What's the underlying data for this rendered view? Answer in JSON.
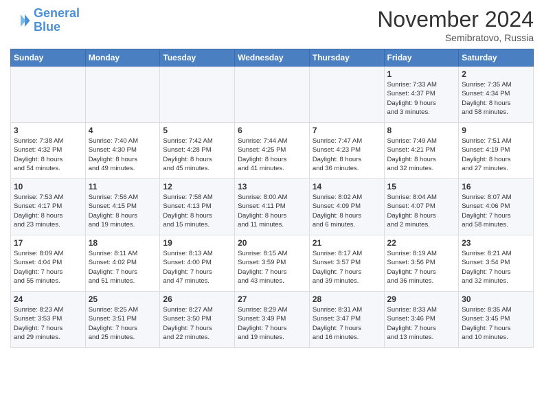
{
  "header": {
    "logo_line1": "General",
    "logo_line2": "Blue",
    "month": "November 2024",
    "location": "Semibratovo, Russia"
  },
  "weekdays": [
    "Sunday",
    "Monday",
    "Tuesday",
    "Wednesday",
    "Thursday",
    "Friday",
    "Saturday"
  ],
  "weeks": [
    [
      {
        "day": "",
        "info": ""
      },
      {
        "day": "",
        "info": ""
      },
      {
        "day": "",
        "info": ""
      },
      {
        "day": "",
        "info": ""
      },
      {
        "day": "",
        "info": ""
      },
      {
        "day": "1",
        "info": "Sunrise: 7:33 AM\nSunset: 4:37 PM\nDaylight: 9 hours\nand 3 minutes."
      },
      {
        "day": "2",
        "info": "Sunrise: 7:35 AM\nSunset: 4:34 PM\nDaylight: 8 hours\nand 58 minutes."
      }
    ],
    [
      {
        "day": "3",
        "info": "Sunrise: 7:38 AM\nSunset: 4:32 PM\nDaylight: 8 hours\nand 54 minutes."
      },
      {
        "day": "4",
        "info": "Sunrise: 7:40 AM\nSunset: 4:30 PM\nDaylight: 8 hours\nand 49 minutes."
      },
      {
        "day": "5",
        "info": "Sunrise: 7:42 AM\nSunset: 4:28 PM\nDaylight: 8 hours\nand 45 minutes."
      },
      {
        "day": "6",
        "info": "Sunrise: 7:44 AM\nSunset: 4:25 PM\nDaylight: 8 hours\nand 41 minutes."
      },
      {
        "day": "7",
        "info": "Sunrise: 7:47 AM\nSunset: 4:23 PM\nDaylight: 8 hours\nand 36 minutes."
      },
      {
        "day": "8",
        "info": "Sunrise: 7:49 AM\nSunset: 4:21 PM\nDaylight: 8 hours\nand 32 minutes."
      },
      {
        "day": "9",
        "info": "Sunrise: 7:51 AM\nSunset: 4:19 PM\nDaylight: 8 hours\nand 27 minutes."
      }
    ],
    [
      {
        "day": "10",
        "info": "Sunrise: 7:53 AM\nSunset: 4:17 PM\nDaylight: 8 hours\nand 23 minutes."
      },
      {
        "day": "11",
        "info": "Sunrise: 7:56 AM\nSunset: 4:15 PM\nDaylight: 8 hours\nand 19 minutes."
      },
      {
        "day": "12",
        "info": "Sunrise: 7:58 AM\nSunset: 4:13 PM\nDaylight: 8 hours\nand 15 minutes."
      },
      {
        "day": "13",
        "info": "Sunrise: 8:00 AM\nSunset: 4:11 PM\nDaylight: 8 hours\nand 11 minutes."
      },
      {
        "day": "14",
        "info": "Sunrise: 8:02 AM\nSunset: 4:09 PM\nDaylight: 8 hours\nand 6 minutes."
      },
      {
        "day": "15",
        "info": "Sunrise: 8:04 AM\nSunset: 4:07 PM\nDaylight: 8 hours\nand 2 minutes."
      },
      {
        "day": "16",
        "info": "Sunrise: 8:07 AM\nSunset: 4:06 PM\nDaylight: 7 hours\nand 58 minutes."
      }
    ],
    [
      {
        "day": "17",
        "info": "Sunrise: 8:09 AM\nSunset: 4:04 PM\nDaylight: 7 hours\nand 55 minutes."
      },
      {
        "day": "18",
        "info": "Sunrise: 8:11 AM\nSunset: 4:02 PM\nDaylight: 7 hours\nand 51 minutes."
      },
      {
        "day": "19",
        "info": "Sunrise: 8:13 AM\nSunset: 4:00 PM\nDaylight: 7 hours\nand 47 minutes."
      },
      {
        "day": "20",
        "info": "Sunrise: 8:15 AM\nSunset: 3:59 PM\nDaylight: 7 hours\nand 43 minutes."
      },
      {
        "day": "21",
        "info": "Sunrise: 8:17 AM\nSunset: 3:57 PM\nDaylight: 7 hours\nand 39 minutes."
      },
      {
        "day": "22",
        "info": "Sunrise: 8:19 AM\nSunset: 3:56 PM\nDaylight: 7 hours\nand 36 minutes."
      },
      {
        "day": "23",
        "info": "Sunrise: 8:21 AM\nSunset: 3:54 PM\nDaylight: 7 hours\nand 32 minutes."
      }
    ],
    [
      {
        "day": "24",
        "info": "Sunrise: 8:23 AM\nSunset: 3:53 PM\nDaylight: 7 hours\nand 29 minutes."
      },
      {
        "day": "25",
        "info": "Sunrise: 8:25 AM\nSunset: 3:51 PM\nDaylight: 7 hours\nand 25 minutes."
      },
      {
        "day": "26",
        "info": "Sunrise: 8:27 AM\nSunset: 3:50 PM\nDaylight: 7 hours\nand 22 minutes."
      },
      {
        "day": "27",
        "info": "Sunrise: 8:29 AM\nSunset: 3:49 PM\nDaylight: 7 hours\nand 19 minutes."
      },
      {
        "day": "28",
        "info": "Sunrise: 8:31 AM\nSunset: 3:47 PM\nDaylight: 7 hours\nand 16 minutes."
      },
      {
        "day": "29",
        "info": "Sunrise: 8:33 AM\nSunset: 3:46 PM\nDaylight: 7 hours\nand 13 minutes."
      },
      {
        "day": "30",
        "info": "Sunrise: 8:35 AM\nSunset: 3:45 PM\nDaylight: 7 hours\nand 10 minutes."
      }
    ]
  ]
}
